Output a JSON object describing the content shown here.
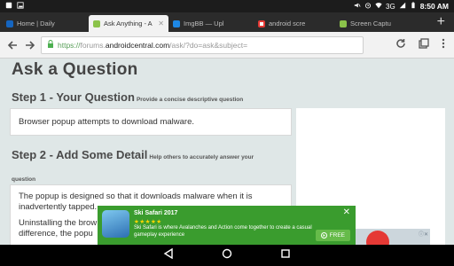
{
  "status_bar": {
    "time": "8:50",
    "ampm": "AM",
    "network": "3G"
  },
  "tabs": [
    {
      "label": "Home | Daily",
      "favicon_color": "#1565c0",
      "active": false
    },
    {
      "label": "Ask Anything - A",
      "favicon_color": "#8bc34a",
      "active": true
    },
    {
      "label": "ImgBB — Upl",
      "favicon_color": "#1e88e5",
      "active": false
    },
    {
      "label": "android scre",
      "favicon_color": "#ffffff",
      "active": false
    },
    {
      "label": "Screen Captu",
      "favicon_color": "#8bc34a",
      "active": false
    }
  ],
  "new_tab_label": "+",
  "url": {
    "scheme": "https://",
    "host_prefix": "forums.",
    "host": "androidcentral.com",
    "path": "/ask/?do=ask&subject="
  },
  "page": {
    "title": "Ask a Question",
    "step1": {
      "heading": "Step 1 - Your Question",
      "hint": "Provide a concise descriptive question",
      "value": "Browser popup attempts to download malware."
    },
    "step2": {
      "heading": "Step 2 - Add Some Detail",
      "hint": "Help others to accurately answer your",
      "hint2": "question",
      "lines": [
        "The popup is designed so that it downloads malware when it is",
        "inadvertently tapped.",
        "Uninstalling the brow",
        "difference, the popu"
      ]
    }
  },
  "ad": {
    "title": "Ski Safari 2017",
    "stars": "★★★★★",
    "description": "Ski Safari is where Avalanches and Action come together to create a casual gameplay experience",
    "cta": "FREE"
  }
}
